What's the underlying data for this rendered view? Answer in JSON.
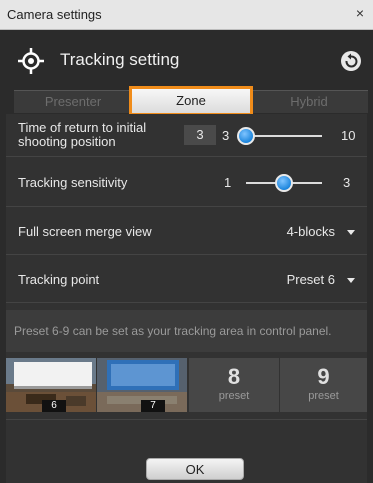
{
  "window": {
    "title": "Camera settings",
    "close_glyph": "×"
  },
  "header": {
    "title": "Tracking setting",
    "icon": "crosshair-target-icon",
    "back_icon": "back-arrow-icon"
  },
  "tabs": [
    {
      "label": "Presenter",
      "active": false
    },
    {
      "label": "Zone",
      "active": true
    },
    {
      "label": "Hybrid",
      "active": false
    }
  ],
  "return_time": {
    "label_line1": "Time of return to initial",
    "label_line2": "shooting position",
    "input_value": "3",
    "min": "3",
    "max": "10",
    "value": 3
  },
  "sensitivity": {
    "label": "Tracking sensitivity",
    "min": "1",
    "max": "3",
    "value": 2
  },
  "merge_view": {
    "label": "Full screen merge view",
    "selected": "4-blocks"
  },
  "tracking_point": {
    "label": "Tracking point",
    "selected": "Preset 6"
  },
  "info_text": "Preset 6-9 can be set as your tracking area in control panel.",
  "presets": [
    {
      "number": "6",
      "type": "thumbnail"
    },
    {
      "number": "7",
      "type": "thumbnail"
    },
    {
      "number": "8",
      "caption": "preset"
    },
    {
      "number": "9",
      "caption": "preset"
    }
  ],
  "ok_label": "OK",
  "colors": {
    "accent_orange": "#f08c1a",
    "slider_blue": "#1d86dd",
    "background": "#2b2b2b"
  }
}
